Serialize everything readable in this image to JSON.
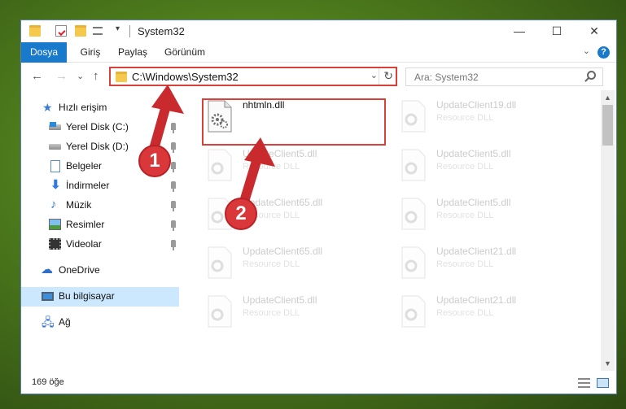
{
  "window": {
    "title": "System32",
    "caption": {
      "minimize": "—",
      "maximize": "☐",
      "close": "✕"
    }
  },
  "ribbon": {
    "tabs": [
      "Dosya",
      "Giriş",
      "Paylaş",
      "Görünüm"
    ],
    "help": "?",
    "collapse": "⌄"
  },
  "address": {
    "path": "C:\\Windows\\System32",
    "dropdown": "⌄",
    "refresh": "↻"
  },
  "search": {
    "placeholder": "Ara: System32"
  },
  "nav_buttons": {
    "back": "←",
    "forward": "→",
    "recent": "⌄",
    "up": "↑"
  },
  "sidebar": {
    "items": [
      {
        "label": "Hızlı erişim",
        "icon": "star-icon"
      },
      {
        "label": "Yerel Disk (C:)",
        "icon": "drive-icon",
        "pinned": true
      },
      {
        "label": "Yerel Disk (D:)",
        "icon": "drive-icon",
        "pinned": true
      },
      {
        "label": "Belgeler",
        "icon": "documents-icon",
        "pinned": true
      },
      {
        "label": "İndirmeler",
        "icon": "download-icon",
        "pinned": true
      },
      {
        "label": "Müzik",
        "icon": "music-icon",
        "pinned": true
      },
      {
        "label": "Resimler",
        "icon": "pictures-icon",
        "pinned": true
      },
      {
        "label": "Videolar",
        "icon": "videos-icon",
        "pinned": true
      },
      {
        "label": "OneDrive",
        "icon": "cloud-icon"
      },
      {
        "label": "Bu bilgisayar",
        "icon": "computer-icon",
        "selected": true
      },
      {
        "label": "Ağ",
        "icon": "network-icon"
      }
    ]
  },
  "files": [
    {
      "name": "nhtmln.dll",
      "type": ""
    },
    {
      "name": "UpdateClient19.dll",
      "type": "Resource DLL"
    },
    {
      "name": "UpdateClient5.dll",
      "type": "Resource DLL"
    },
    {
      "name": "UpdateClient5.dll",
      "type": "Resource DLL"
    },
    {
      "name": "UpdateClient65.dll",
      "type": "Resource DLL"
    },
    {
      "name": "UpdateClient5.dll",
      "type": "Resource DLL"
    },
    {
      "name": "UpdateClient65.dll",
      "type": "Resource DLL"
    },
    {
      "name": "UpdateClient21.dll",
      "type": "Resource DLL"
    },
    {
      "name": "UpdateClient5.dll",
      "type": "Resource DLL"
    },
    {
      "name": "UpdateClient21.dll",
      "type": "Resource DLL"
    }
  ],
  "status": {
    "item_count": "169 öğe"
  },
  "annotations": {
    "step1": "1",
    "step2": "2"
  },
  "colors": {
    "accent": "#1979ca",
    "highlight": "#d9403a",
    "selected": "#cce8ff"
  }
}
